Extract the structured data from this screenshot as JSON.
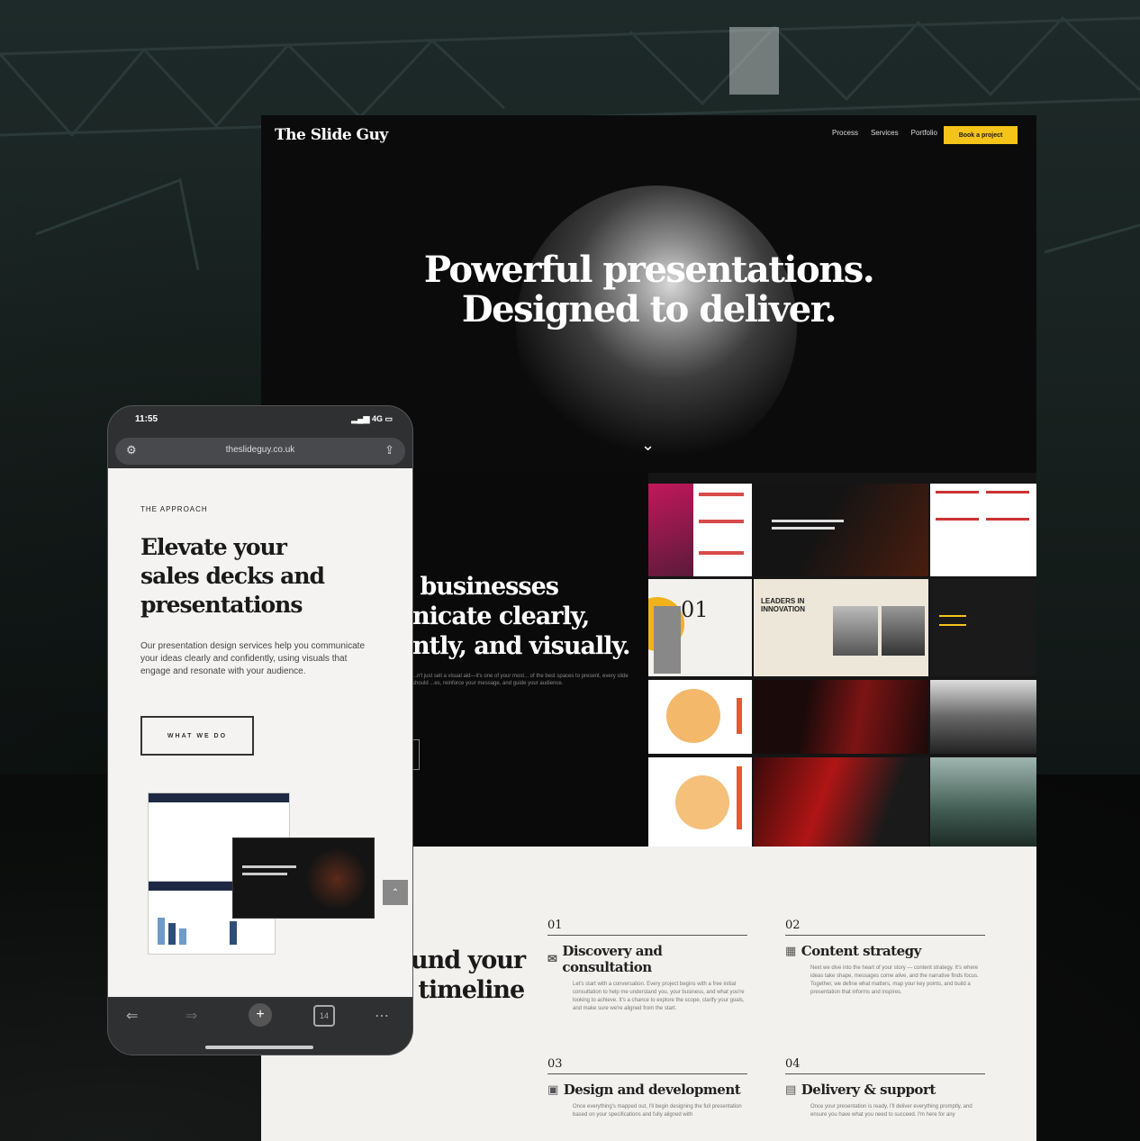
{
  "desktop": {
    "logo": "The Slide Guy",
    "nav": [
      "Process",
      "Services",
      "Portfolio"
    ],
    "cta_label": "Book a project",
    "hero_line1": "Powerful presentations.",
    "hero_line2": "Designed to deliver.",
    "section2_heading": " businesses\nnicate clearly,\nntly, and visually.",
    "section2_body": "...n't just sell a visual aid—it's one of your most... of the best spaces to present, every slide should ...es, reinforce your message, and guide your audience.",
    "section3_heading": "und your\n timeline",
    "steps": [
      {
        "num": "01",
        "title": "Discovery and consultation",
        "icon": "speech-icon",
        "body": "Let's start with a conversation. Every project begins with a free initial consultation to help me understand you, your business, and what you're looking to achieve. It's a chance to explore the scope, clarify your goals, and make sure we're aligned from the start."
      },
      {
        "num": "02",
        "title": "Content strategy",
        "icon": "grid-icon",
        "body": "Next we dive into the heart of your story — content strategy. It's where ideas take shape, messages come alive, and the narrative finds focus. Together, we define what matters, map your key points, and build a presentation that informs and inspires."
      },
      {
        "num": "03",
        "title": "Design and development",
        "icon": "layout-icon",
        "body": "Once everything's mapped out, I'll begin designing the full presentation based on your specifications and fully aligned with"
      },
      {
        "num": "04",
        "title": "Delivery & support",
        "icon": "doc-icon",
        "body": "Once your presentation is ready, I'll deliver everything promptly, and ensure you have what you need to succeed. I'm here for any"
      }
    ]
  },
  "phone": {
    "time": "11:55",
    "status_right": "4G",
    "url": "theslideguy.co.uk",
    "kicker": "THE APPROACH",
    "heading": "Elevate your\nsales decks and\npresentations",
    "body": "Our presentation design services help you communicate your ideas clearly and confidently, using visuals that engage and resonate with your audience.",
    "button_label": "WHAT WE DO"
  },
  "colors": {
    "accent": "#f5c41a",
    "hero_dot": "#d79b2c",
    "page_light": "#f3f1ee"
  }
}
